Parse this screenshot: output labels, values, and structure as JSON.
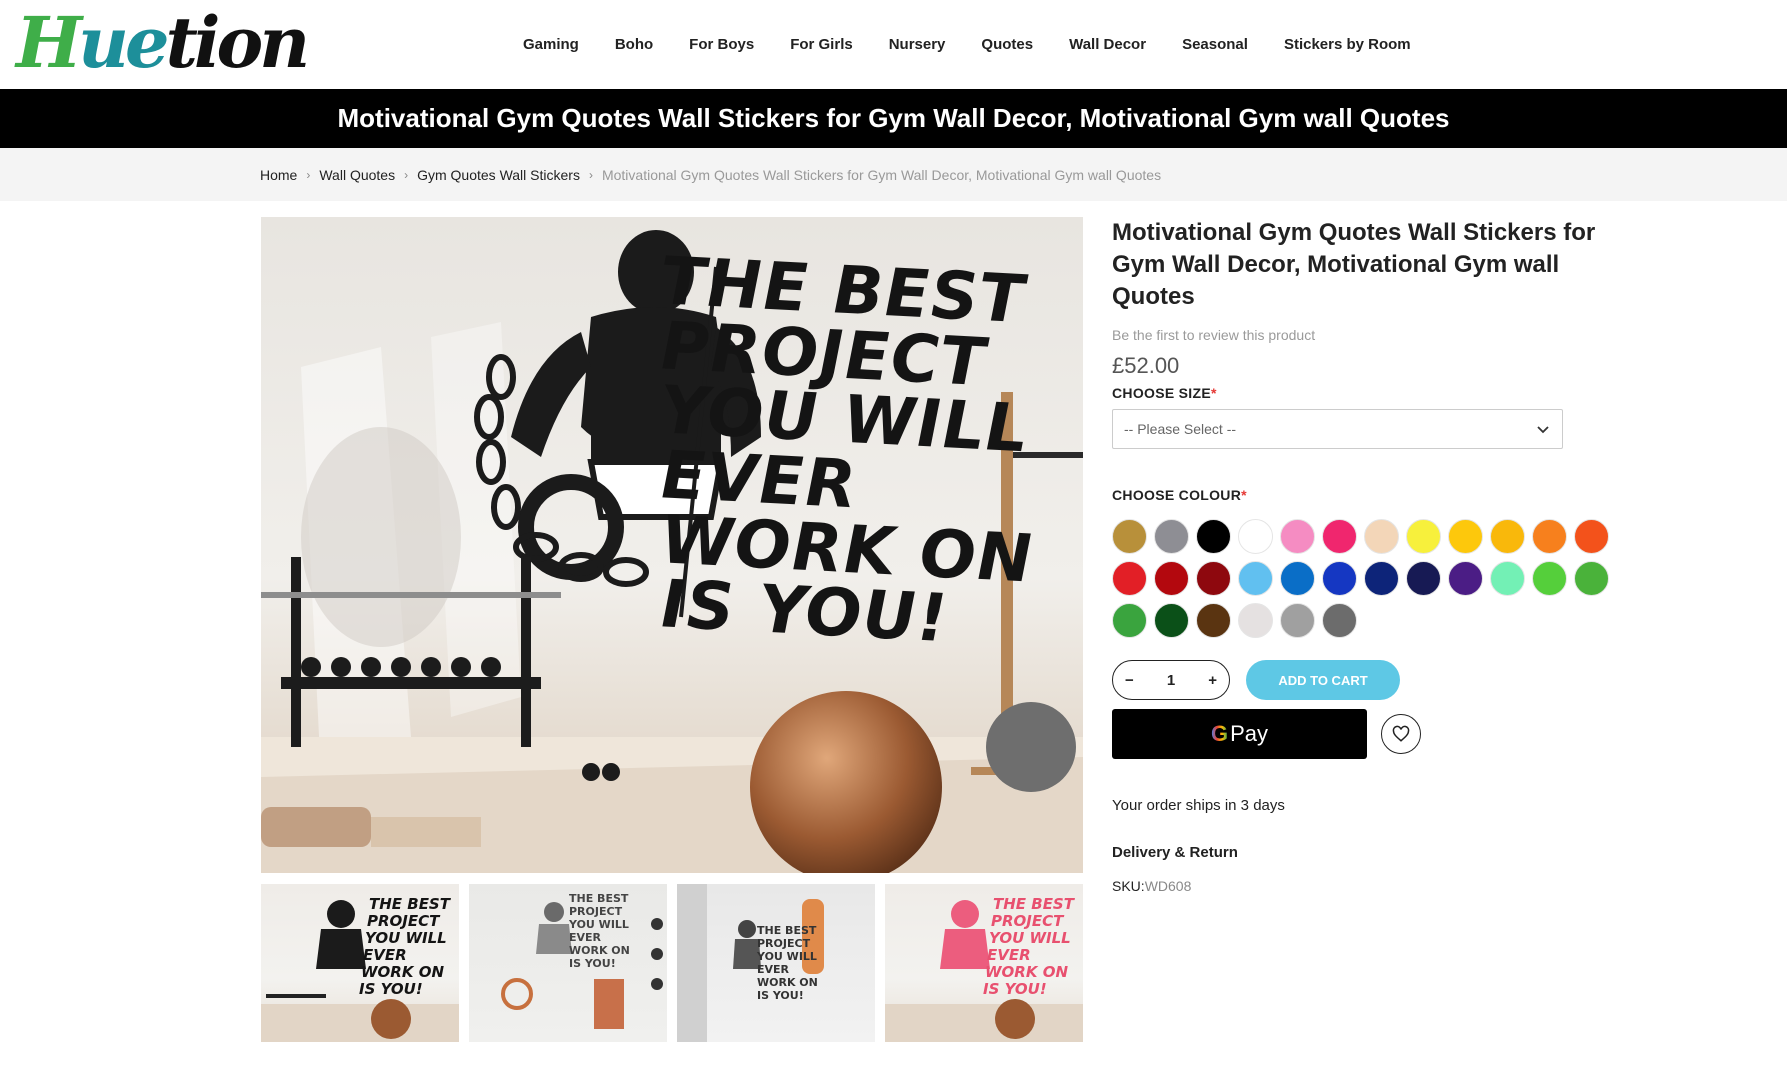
{
  "brand": {
    "logo_text_1": "H",
    "logo_text_2": "ue",
    "logo_text_3": "tion"
  },
  "nav": [
    "Gaming",
    "Boho",
    "For Boys",
    "For Girls",
    "Nursery",
    "Quotes",
    "Wall Decor",
    "Seasonal",
    "Stickers by Room"
  ],
  "banner": {
    "title": "Motivational Gym Quotes Wall Stickers for Gym Wall Decor, Motivational Gym wall Quotes"
  },
  "breadcrumb": {
    "items": [
      "Home",
      "Wall Quotes",
      "Gym Quotes Wall Stickers"
    ],
    "current": "Motivational Gym Quotes Wall Stickers for Gym Wall Decor, Motivational Gym wall Quotes",
    "separator": "›"
  },
  "gallery": {
    "poster_lines": [
      "THE BEST",
      "PROJECT",
      "YOU WILL",
      "EVER",
      "WORK ON",
      "IS YOU!"
    ],
    "thumb_count": 4
  },
  "product": {
    "title": "Motivational Gym Quotes Wall Stickers for Gym Wall Decor, Motivational Gym wall Quotes",
    "review_text": "Be the first to review this product",
    "price": "£52.00",
    "size_label": "CHOOSE SIZE",
    "required_mark": "*",
    "size_placeholder": "-- Please Select --",
    "colour_label": "CHOOSE COLOUR",
    "colours": [
      "#b8903a",
      "#8e8e94",
      "#000000",
      "#ffffff",
      "#f58cc2",
      "#f0266e",
      "#f3d6b8",
      "#f7f03c",
      "#fdc80c",
      "#f9b80b",
      "#f7801d",
      "#f3521b",
      "#e21f26",
      "#b3080e",
      "#8e080e",
      "#61c0f0",
      "#0a6ec7",
      "#1537c2",
      "#0d2479",
      "#171a54",
      "#4b1d85",
      "#73f0b5",
      "#55cf3b",
      "#4ab23a",
      "#3aa43e",
      "#0b5018",
      "#5a3411",
      "#e5e1e1",
      "#a0a0a0",
      "#6c6c6c"
    ],
    "quantity": "1",
    "minus": "−",
    "plus": "+",
    "add_to_cart": "ADD TO CART",
    "gpay_g": "G",
    "gpay_label": "Pay",
    "ships_text": "Your order ships in 3 days",
    "delivery_label": "Delivery & Return",
    "sku_label": "SKU:",
    "sku_value": "WD608"
  }
}
